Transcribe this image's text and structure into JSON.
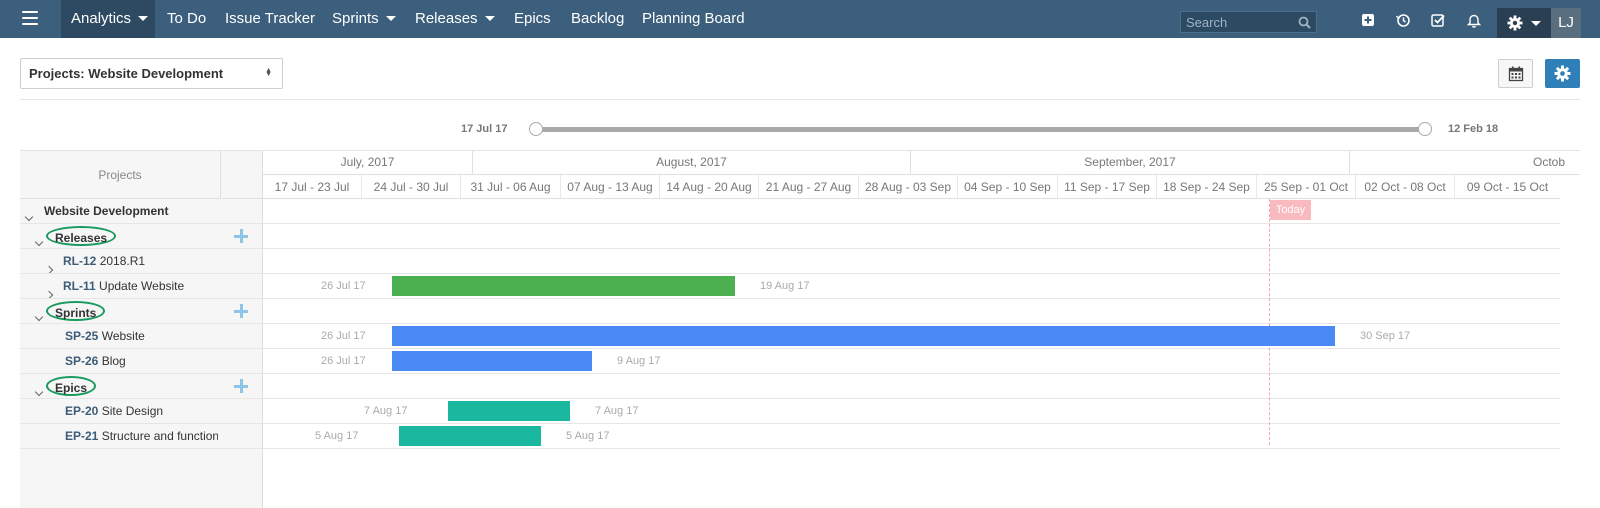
{
  "nav": {
    "menu_icon": "hamburger-menu-icon",
    "items": [
      {
        "label": "Analytics",
        "dropdown": true,
        "active": true
      },
      {
        "label": "To Do"
      },
      {
        "label": "Issue Tracker"
      },
      {
        "label": "Sprints",
        "dropdown": true
      },
      {
        "label": "Releases",
        "dropdown": true
      },
      {
        "label": "Epics"
      },
      {
        "label": "Backlog"
      },
      {
        "label": "Planning Board"
      }
    ],
    "search_placeholder": "Search",
    "icons": [
      "plus-square-icon",
      "history-icon",
      "check-square-icon",
      "bell-icon"
    ],
    "settings_icon": "gear-icon",
    "user_initials": "LJ",
    "bar_color": "#3b5f7c"
  },
  "toolbar": {
    "project_select": "Projects: Website Development",
    "calendar_icon": "calendar-icon",
    "settings_icon": "gear-icon"
  },
  "range": {
    "start": "17 Jul 17",
    "end": "12 Feb 18"
  },
  "gantt": {
    "left_header": "Projects",
    "months": [
      "July, 2017",
      "August, 2017",
      "September, 2017",
      "Octob"
    ],
    "weeks": [
      "17 Jul - 23 Jul",
      "24 Jul - 30 Jul",
      "31 Jul - 06 Aug",
      "07 Aug - 13 Aug",
      "14 Aug - 20 Aug",
      "21 Aug - 27 Aug",
      "28 Aug - 03 Sep",
      "04 Sep - 10 Sep",
      "11 Sep - 17 Sep",
      "18 Sep - 24 Sep",
      "25 Sep - 01 Oct",
      "02 Oct - 08 Oct",
      "09 Oct - 15 Oct"
    ],
    "today_label": "Today",
    "project": "Website Development",
    "groups": {
      "releases": "Releases",
      "sprints": "Sprints",
      "epics": "Epics"
    },
    "rows": {
      "rl12": {
        "key": "RL-12",
        "name": "2018.R1"
      },
      "rl11": {
        "key": "RL-11",
        "name": "Update Website",
        "start": "26 Jul 17",
        "end": "19 Aug 17",
        "color": "#4caf50"
      },
      "sp25": {
        "key": "SP-25",
        "name": "Website",
        "start": "26 Jul 17",
        "end": "30 Sep 17",
        "color": "#4a8af4"
      },
      "sp26": {
        "key": "SP-26",
        "name": "Blog",
        "start": "26 Jul 17",
        "end": "9 Aug 17",
        "color": "#4a8af4"
      },
      "ep20": {
        "key": "EP-20",
        "name": "Site Design",
        "start": "7 Aug 17",
        "end": "7 Aug 17",
        "color": "#1ab89e"
      },
      "ep21": {
        "key": "EP-21",
        "name": "Structure and functions",
        "start": "5 Aug 17",
        "end": "5 Aug 17",
        "color": "#1ab89e"
      }
    }
  }
}
